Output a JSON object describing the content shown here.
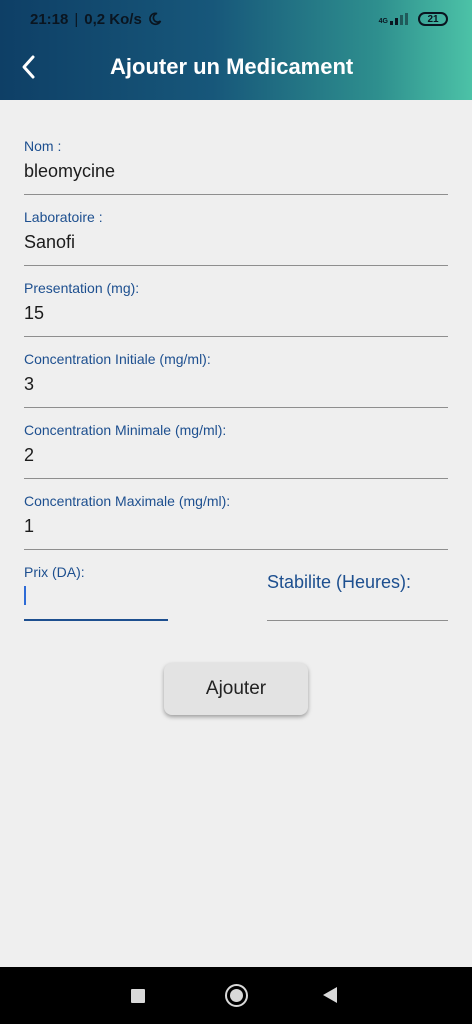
{
  "status_bar": {
    "time": "21:18",
    "speed": "0,2 Ko/s",
    "moon_icon": "moon-icon",
    "network": "4G",
    "battery": "21"
  },
  "header": {
    "title": "Ajouter un Medicament",
    "back_icon": "chevron-left-icon"
  },
  "form": {
    "nom": {
      "label": "Nom :",
      "value": "bleomycine"
    },
    "laboratoire": {
      "label": "Laboratoire :",
      "value": "Sanofi"
    },
    "presentation": {
      "label": "Presentation (mg):",
      "value": "15"
    },
    "conc_initiale": {
      "label": "Concentration Initiale (mg/ml):",
      "value": "3"
    },
    "conc_minimale": {
      "label": "Concentration Minimale (mg/ml):",
      "value": "2"
    },
    "conc_maximale": {
      "label": "Concentration Maximale (mg/ml):",
      "value": "1"
    },
    "prix": {
      "label": "Prix (DA):",
      "value": ""
    },
    "stabilite": {
      "label": "Stabilite (Heures):"
    }
  },
  "submit_label": "Ajouter",
  "colors": {
    "label": "#1d4f8f",
    "header_start": "#0e3f66",
    "header_end": "#4cc2a7",
    "background": "#efefef"
  },
  "nav_bar": {
    "recents_icon": "square-icon",
    "home_icon": "circle-home-icon",
    "back_icon": "triangle-back-icon"
  }
}
